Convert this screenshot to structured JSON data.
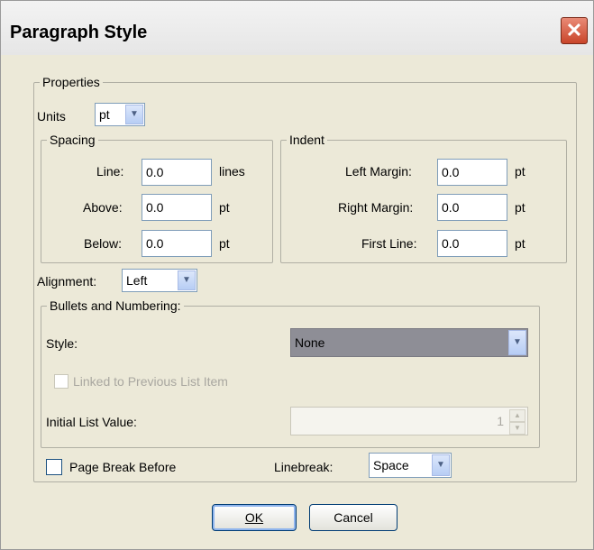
{
  "window": {
    "title": "Paragraph Style",
    "close_glyph": "✕"
  },
  "properties": {
    "label": "Properties",
    "units_label": "Units",
    "units_value": "pt",
    "spacing": {
      "label": "Spacing",
      "line_label": "Line:",
      "line_value": "0.0",
      "line_unit": "lines",
      "above_label": "Above:",
      "above_value": "0.0",
      "above_unit": "pt",
      "below_label": "Below:",
      "below_value": "0.0",
      "below_unit": "pt"
    },
    "indent": {
      "label": "Indent",
      "left_label": "Left Margin:",
      "left_value": "0.0",
      "left_unit": "pt",
      "right_label": "Right Margin:",
      "right_value": "0.0",
      "right_unit": "pt",
      "first_label": "First Line:",
      "first_value": "0.0",
      "first_unit": "pt"
    },
    "alignment_label": "Alignment:",
    "alignment_value": "Left",
    "bullets": {
      "label": "Bullets and Numbering:",
      "style_label": "Style:",
      "style_value": "None",
      "linked_label": "Linked to Previous List Item",
      "initial_label": "Initial List Value:",
      "initial_value": "1"
    },
    "page_break_label": "Page Break Before",
    "linebreak_label": "Linebreak:",
    "linebreak_value": "Space"
  },
  "buttons": {
    "ok": "OK",
    "cancel": "Cancel"
  },
  "icons": {
    "dropdown": "chevron-down-icon",
    "close": "close-icon"
  }
}
